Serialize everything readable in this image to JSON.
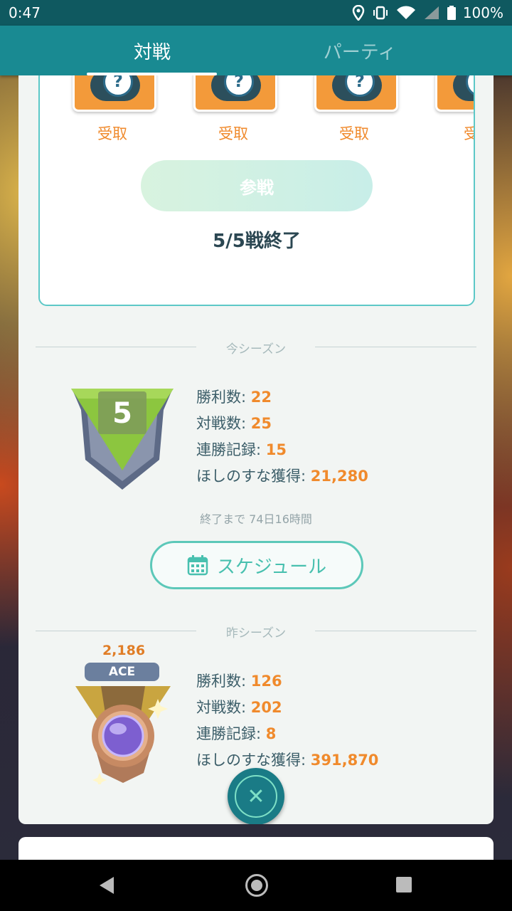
{
  "status_bar": {
    "time": "0:47",
    "battery": "100%"
  },
  "tabs": [
    {
      "label": "対戦",
      "active": true
    },
    {
      "label": "パーティ",
      "active": false
    }
  ],
  "rewards": [
    {
      "label": "受取"
    },
    {
      "label": "受取"
    },
    {
      "label": "受取"
    },
    {
      "label": "受"
    }
  ],
  "join_button": {
    "label": "参戦"
  },
  "battle_status": "5/5戦終了",
  "current_season": {
    "title": "今シーズン",
    "rank": "5",
    "stats": [
      {
        "label": "勝利数:",
        "value": "22"
      },
      {
        "label": "対戦数:",
        "value": "25"
      },
      {
        "label": "連勝記録:",
        "value": "15"
      },
      {
        "label": "ほしのすな獲得:",
        "value": "21,280"
      }
    ],
    "time_left": "終了まで 74日16時間",
    "schedule_button": "スケジュール"
  },
  "previous_season": {
    "title": "昨シーズン",
    "rating": "2,186",
    "rank_name": "ACE",
    "stats": [
      {
        "label": "勝利数:",
        "value": "126"
      },
      {
        "label": "対戦数:",
        "value": "202"
      },
      {
        "label": "連勝記録:",
        "value": "8"
      },
      {
        "label": "ほしのすな獲得:",
        "value": "391,870"
      }
    ]
  },
  "colors": {
    "teal": "#198a92",
    "orange": "#f08a2c",
    "text": "#3c5e69"
  }
}
